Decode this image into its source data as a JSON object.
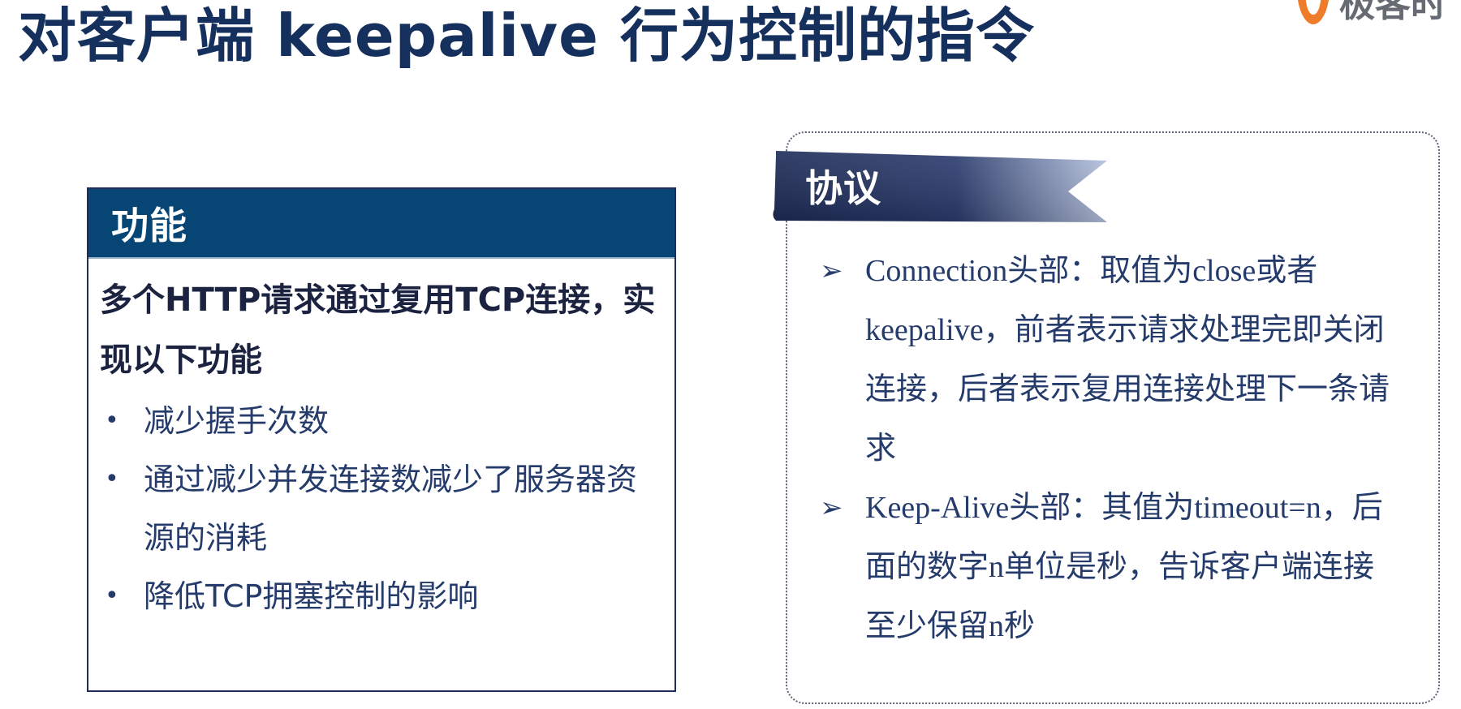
{
  "title": "对客户端 keepalive 行为控制的指令",
  "logo": {
    "text": "极客时",
    "icon": "geektime-logo-icon",
    "color": "#ef7c2a"
  },
  "features": {
    "heading": "功能",
    "lead": "多个HTTP请求通过复用TCP连接，实现以下功能",
    "items": [
      "减少握手次数",
      "通过减少并发连接数减少了服务器资源的消耗",
      "降低TCP拥塞控制的影响"
    ]
  },
  "protocol": {
    "heading": "协议",
    "items": [
      "Connection头部：取值为close或者keepalive，前者表示请求处理完即关闭连接，后者表示复用连接处理下一条请求",
      "Keep-Alive头部：其值为timeout=n，后面的数字n单位是秒，告诉客户端连接至少保留n秒"
    ]
  },
  "colors": {
    "title": "#16305e",
    "feature_header_bg": "#064574",
    "ribbon_dark": "#1c2a55",
    "ribbon_light": "#b7c4e0",
    "body_text": "#243b6b"
  }
}
